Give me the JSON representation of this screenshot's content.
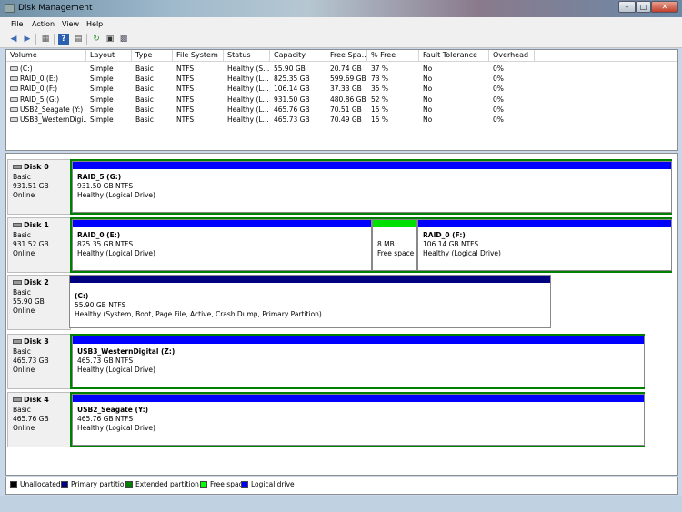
{
  "window": {
    "title": "Disk Management"
  },
  "menu": [
    "File",
    "Action",
    "View",
    "Help"
  ],
  "toolbar_icons": [
    "back-icon",
    "forward-icon",
    "console-tree-icon",
    "list-icon",
    "help-icon",
    "properties-icon",
    "refresh-icon",
    "rescan-icon",
    "settings-icon"
  ],
  "volumes": {
    "columns": [
      "Volume",
      "Layout",
      "Type",
      "File System",
      "Status",
      "Capacity",
      "Free Spa...",
      "% Free",
      "Fault Tolerance",
      "Overhead"
    ],
    "rows": [
      [
        "(C:)",
        "Simple",
        "Basic",
        "NTFS",
        "Healthy (S...",
        "55.90 GB",
        "20.74 GB",
        "37 %",
        "No",
        "0%"
      ],
      [
        "RAID_0 (E:)",
        "Simple",
        "Basic",
        "NTFS",
        "Healthy (L...",
        "825.35 GB",
        "599.69 GB",
        "73 %",
        "No",
        "0%"
      ],
      [
        "RAID_0 (F:)",
        "Simple",
        "Basic",
        "NTFS",
        "Healthy (L...",
        "106.14 GB",
        "37.33 GB",
        "35 %",
        "No",
        "0%"
      ],
      [
        "RAID_5 (G:)",
        "Simple",
        "Basic",
        "NTFS",
        "Healthy (L...",
        "931.50 GB",
        "480.86 GB",
        "52 %",
        "No",
        "0%"
      ],
      [
        "USB2_Seagate (Y:)",
        "Simple",
        "Basic",
        "NTFS",
        "Healthy (L...",
        "465.76 GB",
        "70.51 GB",
        "15 %",
        "No",
        "0%"
      ],
      [
        "USB3_WesternDigi...",
        "Simple",
        "Basic",
        "NTFS",
        "Healthy (L...",
        "465.73 GB",
        "70.49 GB",
        "15 %",
        "No",
        "0%"
      ]
    ]
  },
  "disks": [
    {
      "name": "Disk 0",
      "type": "Basic",
      "size": "931.51 GB",
      "status": "Online",
      "partitions": [
        {
          "name": "RAID_5  (G:)",
          "size": "931.50 GB NTFS",
          "status": "Healthy (Logical Drive)",
          "kind": "logical"
        }
      ]
    },
    {
      "name": "Disk 1",
      "type": "Basic",
      "size": "931.52 GB",
      "status": "Online",
      "partitions": [
        {
          "name": "RAID_0  (E:)",
          "size": "825.35 GB NTFS",
          "status": "Healthy (Logical Drive)",
          "kind": "logical"
        },
        {
          "name": "",
          "size": "8 MB",
          "status": "Free space",
          "kind": "free"
        },
        {
          "name": "RAID_0  (F:)",
          "size": "106.14 GB NTFS",
          "status": "Healthy (Logical Drive)",
          "kind": "logical"
        }
      ]
    },
    {
      "name": "Disk 2",
      "type": "Basic",
      "size": "55.90 GB",
      "status": "Online",
      "partitions": [
        {
          "name": "(C:)",
          "size": "55.90 GB NTFS",
          "status": "Healthy (System, Boot, Page File, Active, Crash Dump, Primary Partition)",
          "kind": "primary"
        }
      ]
    },
    {
      "name": "Disk 3",
      "type": "Basic",
      "size": "465.73 GB",
      "status": "Online",
      "partitions": [
        {
          "name": "USB3_WesternDigital  (Z:)",
          "size": "465.73 GB NTFS",
          "status": "Healthy (Logical Drive)",
          "kind": "logical"
        }
      ]
    },
    {
      "name": "Disk 4",
      "type": "Basic",
      "size": "465.76 GB",
      "status": "Online",
      "partitions": [
        {
          "name": "USB2_Seagate  (Y:)",
          "size": "465.76 GB NTFS",
          "status": "Healthy (Logical Drive)",
          "kind": "logical"
        }
      ]
    }
  ],
  "legend": [
    {
      "label": "Unallocated",
      "color": "#000000"
    },
    {
      "label": "Primary partition",
      "color": "#000080"
    },
    {
      "label": "Extended partition",
      "color": "#008000"
    },
    {
      "label": "Free space",
      "color": "#00ff00"
    },
    {
      "label": "Logical drive",
      "color": "#0000ff"
    }
  ],
  "colors": {
    "logical": "#0000ff",
    "primary": "#000080",
    "extended": "#008000",
    "free": "#00e000"
  }
}
